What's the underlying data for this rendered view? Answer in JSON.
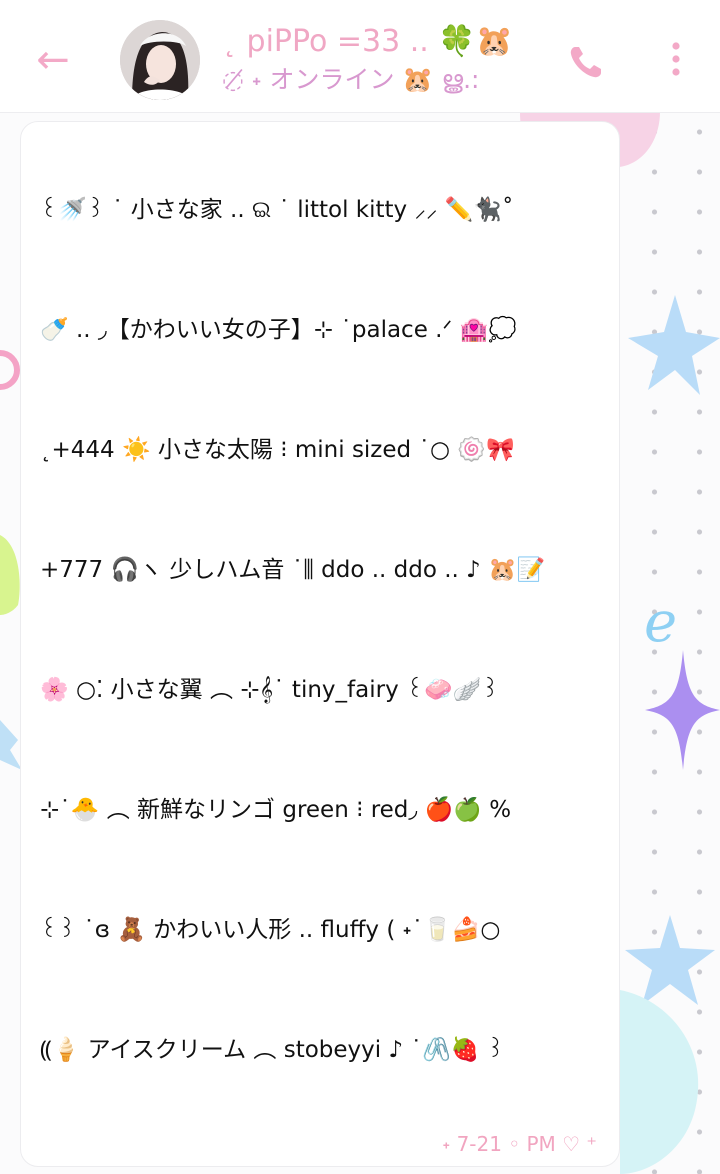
{
  "header": {
    "back_icon": "arrow-left-icon",
    "title": "˛ piPPo =33 .. 🍀🐹",
    "subtitle": "◌̸ ˖ オンライン 🐹 ൠ.:",
    "call_icon": "phone-icon",
    "more_icon": "more-vertical-icon"
  },
  "message": {
    "lines": [
      "꒰🚿꒱ ˙ 小さな家  ..  ଇ ˙ littol  kitty  ⸝⸝ ✏️🐈‍⬛˚",
      "🍼 .. ◞【かわいい女の子】⊹ ˙palace .ᐟ 🏩💭",
      "˛+444 ☀️  小さな太陽  ⁝ mini  sized ˙○ 🍥🎀",
      "+777 🎧ヽ 少しハム音 ˙⫼ ddo .. ddo .. ♪ 🐹📝",
      "🌸 ○⁚  小さな翼   ︵ ⊹𝄞˙ tiny_fairy ꒰🧼🪽꒱",
      "⊹˙🐣 ︵  新鮮なリンゴ  green ⁝ red◞ 🍎🍏 %",
      "꒰꒱ ˙ɞ  🧸  かわいい人形  ..  fluffy  ( ˖˙🥛🍰○",
      "⸨🍦 アイスクリーム  ︵  stobeyyi  ♪ ˙🖇️🍓 ꒱",
      ""
    ],
    "timestamp": "˖ 7-21 ◦ PM ♡ ⁺"
  },
  "colors": {
    "accent_pink": "#f3a9c7",
    "subtitle_pink": "#d898cf",
    "bubble_bg": "#ffffff",
    "text": "#111111"
  }
}
